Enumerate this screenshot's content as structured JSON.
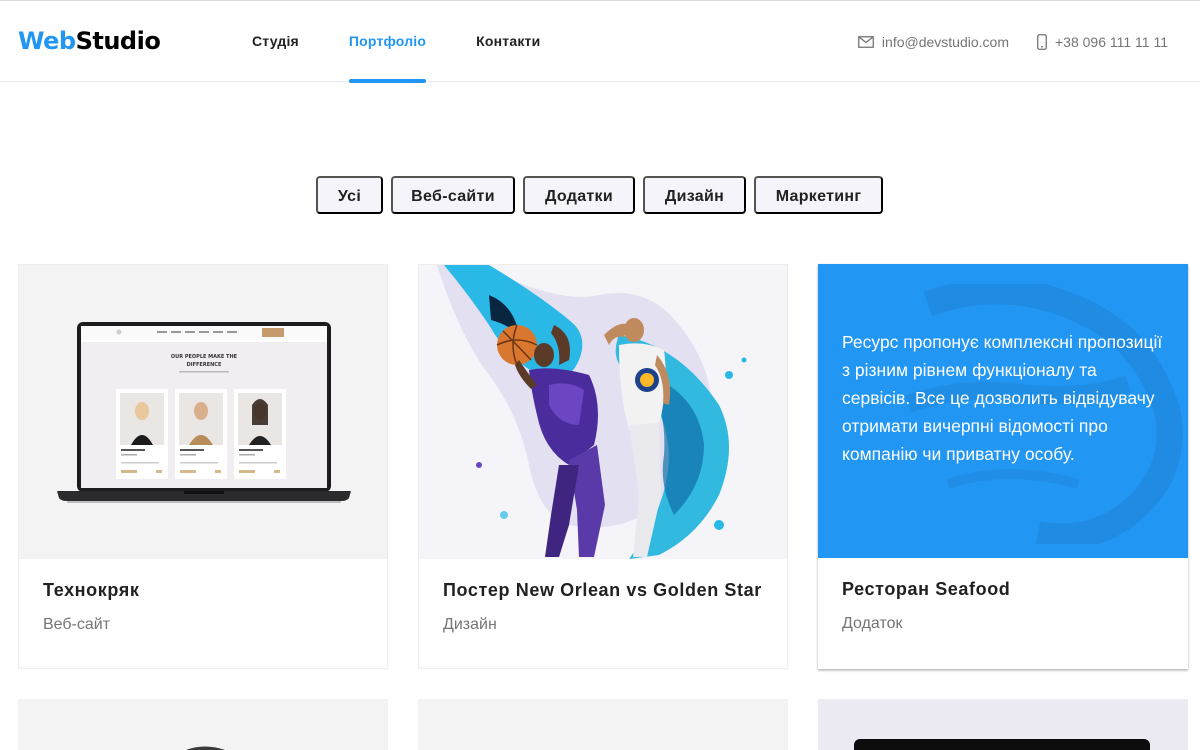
{
  "header": {
    "logo_part1": "Web",
    "logo_part2": "Studio",
    "nav": [
      "Студія",
      "Портфоліо",
      "Контакти"
    ],
    "active_nav": "Портфоліо",
    "email": "info@devstudio.com",
    "phone": "+38 096 111 11 11"
  },
  "filters": [
    "Усі",
    "Веб-сайти",
    "Додатки",
    "Дизайн",
    "Маркетинг"
  ],
  "cards": [
    {
      "title": "Технокряк",
      "category": "Веб-сайт"
    },
    {
      "title": "Постер New Orlean vs Golden Star",
      "category": "Дизайн"
    },
    {
      "title": "Ресторан Seafood",
      "category": "Додаток",
      "overlay_text": "Ресурс пропонує комплексні пропозиції з різним рівнем функціоналу та сервісів. Все це дозволить відвідувачу отримати вичерпні відомості про компанію чи приватну особу."
    }
  ],
  "mockup": {
    "headline_1": "OUR PEOPLE MAKE THE",
    "headline_2": "DIFFERENCE"
  },
  "icons": {
    "email": "mail-icon",
    "phone": "phone-icon"
  },
  "colors": {
    "accent": "#2196f3",
    "filter_bg": "#f5f4fa",
    "text": "#212121",
    "muted": "#757575"
  }
}
